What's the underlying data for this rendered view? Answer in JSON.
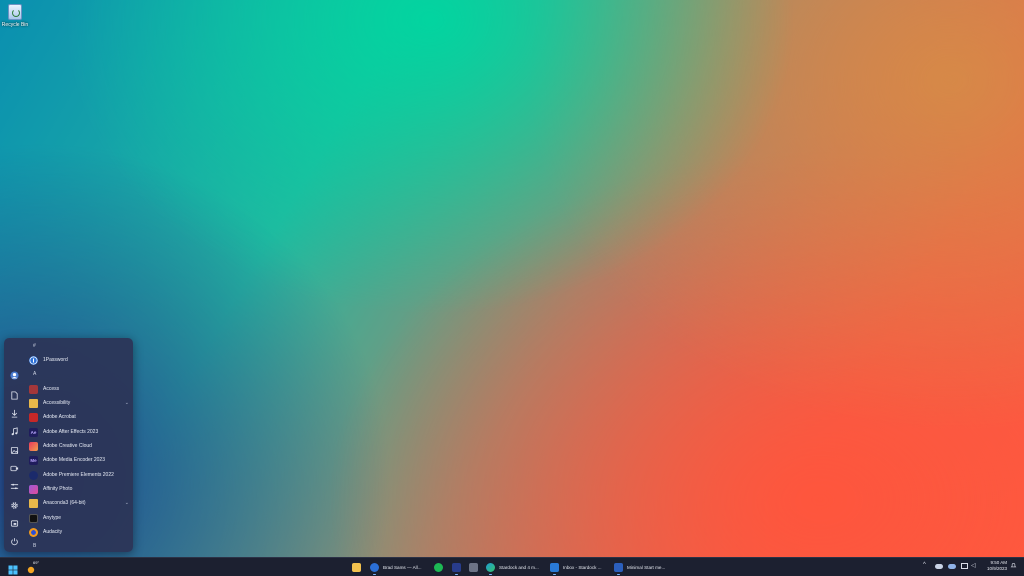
{
  "desktop": {
    "recycle_bin_label": "Recycle Bin"
  },
  "start_menu": {
    "rail_icons": [
      "user-avatar-icon",
      "document-icon",
      "download-icon",
      "music-icon",
      "picture-icon",
      "video-icon",
      "settings-sliders-icon",
      "gear-icon",
      "file-explorer-icon",
      "power-icon"
    ],
    "sections": [
      {
        "header": "#",
        "items": [
          {
            "label": "1Password",
            "icon": "1password-icon",
            "color": "#2b6fd6"
          }
        ]
      },
      {
        "header": "A",
        "items": [
          {
            "label": "Access",
            "icon": "access-icon",
            "color": "#a4373a"
          },
          {
            "label": "Accessibility",
            "icon": "folder-icon",
            "color": "#e8b84a",
            "expandable": true
          },
          {
            "label": "Adobe Acrobat",
            "icon": "acrobat-icon",
            "color": "#c62828"
          },
          {
            "label": "Adobe After Effects 2023",
            "icon": "after-effects-icon",
            "color": "#1f1c5c",
            "abbr": "Ae"
          },
          {
            "label": "Adobe Creative Cloud",
            "icon": "creative-cloud-icon",
            "color": "#e8385e"
          },
          {
            "label": "Adobe Media Encoder 2023",
            "icon": "media-encoder-icon",
            "color": "#1f1c5c",
            "abbr": "Me"
          },
          {
            "label": "Adobe Premiere Elements 2022",
            "icon": "premiere-elements-icon",
            "color": "#1b2a6b"
          },
          {
            "label": "Affinity Photo",
            "icon": "affinity-photo-icon",
            "color": "#9b5bd6"
          },
          {
            "label": "Anaconda3 (64-bit)",
            "icon": "folder-icon",
            "color": "#e8b84a",
            "expandable": true
          },
          {
            "label": "Anytype",
            "icon": "anytype-icon",
            "color": "#111111"
          },
          {
            "label": "Audacity",
            "icon": "audacity-icon",
            "color": "#f29a1f"
          }
        ]
      },
      {
        "header": "B",
        "items": []
      }
    ],
    "chevron": "⌄"
  },
  "taskbar": {
    "start_icon": "windows-start-icon",
    "weather_temp": "69°",
    "pinned": [
      {
        "label": "",
        "icon": "file-explorer-icon",
        "color": "#f2c14e"
      },
      {
        "label": "Brad Sams — All...",
        "icon": "1password-icon",
        "color": "#2b6fd6"
      },
      {
        "label": "",
        "icon": "spotify-icon",
        "color": "#1db954"
      },
      {
        "label": "",
        "icon": "dark-app-icon",
        "color": "#283c8c"
      },
      {
        "label": "",
        "icon": "rss-icon",
        "color": "#6d7386"
      },
      {
        "label": "Stardock and 4 m...",
        "icon": "edge-icon",
        "color": "#1f9bd4"
      },
      {
        "label": "Inbox - Stardock ...",
        "icon": "mail-icon",
        "color": "#2a7ad6"
      },
      {
        "label": "Minimal Start me...",
        "icon": "word-icon",
        "color": "#2b5fbd"
      }
    ],
    "tray": {
      "icons": [
        "chevron-up-icon",
        "onedrive-icon",
        "cloud-icon",
        "network-icon",
        "speaker-icon"
      ],
      "time": "9:50 AM",
      "date": "10/9/2023"
    }
  }
}
